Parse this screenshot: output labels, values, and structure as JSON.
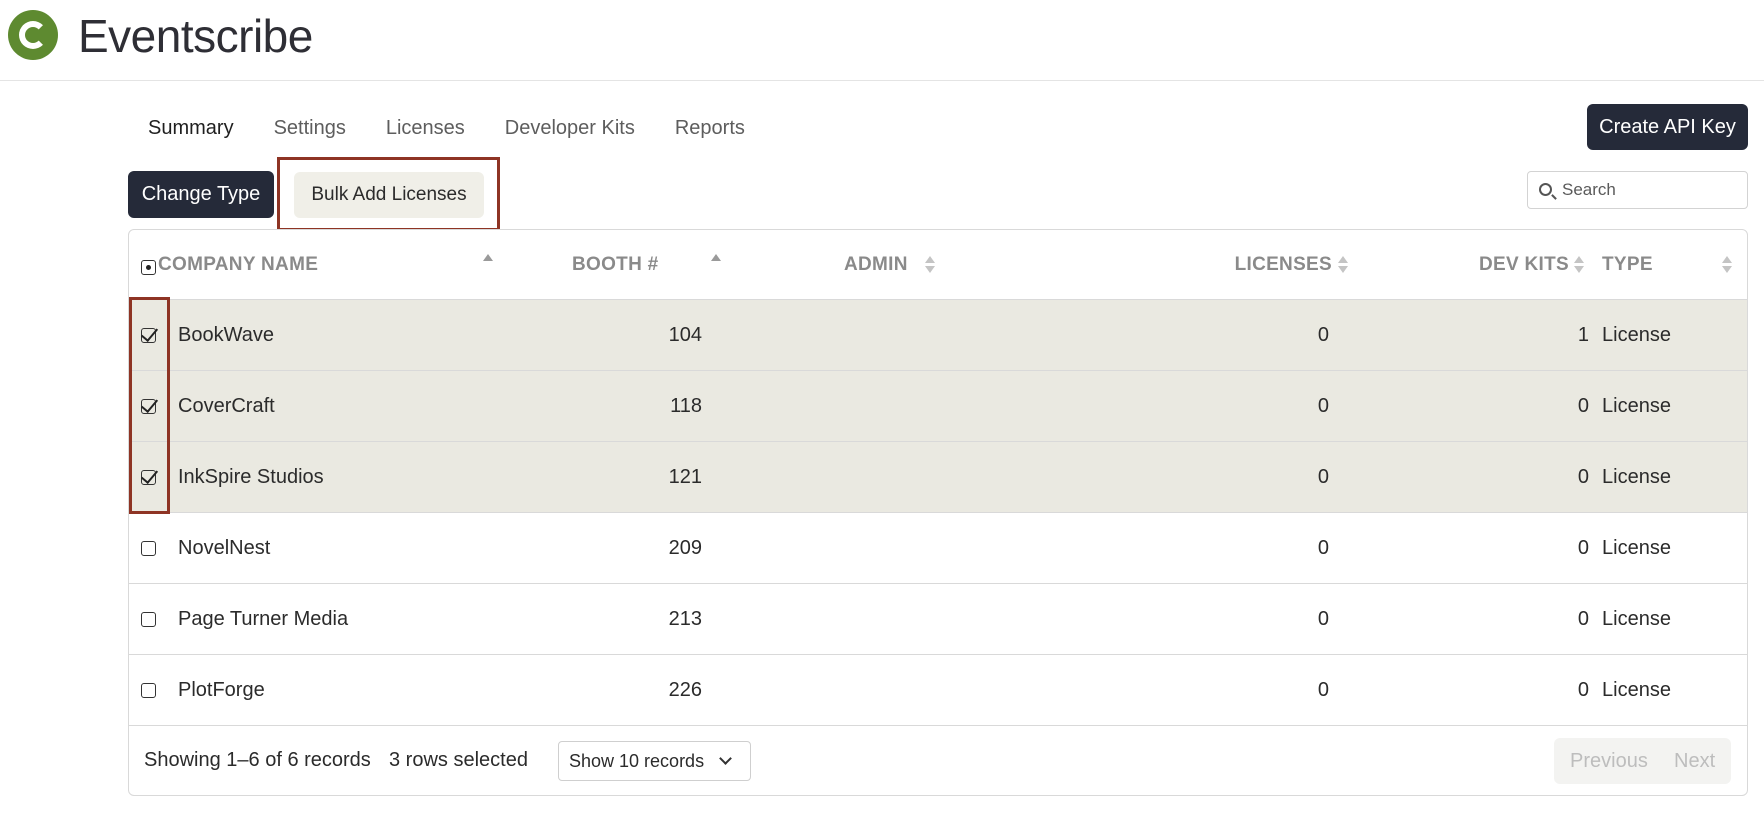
{
  "header": {
    "app_title": "Eventscribe",
    "logo_icon": "eventscribe-logo-icon",
    "brand_color": "#5e8a30"
  },
  "nav": {
    "tabs": [
      {
        "label": "Summary",
        "active": true
      },
      {
        "label": "Settings",
        "active": false
      },
      {
        "label": "Licenses",
        "active": false
      },
      {
        "label": "Developer Kits",
        "active": false
      },
      {
        "label": "Reports",
        "active": false
      }
    ]
  },
  "toolbar": {
    "create_api_key_label": "Create API Key",
    "change_type_label": "Change Type",
    "bulk_add_licenses_label": "Bulk Add Licenses",
    "search_placeholder": "Search"
  },
  "table": {
    "columns": [
      {
        "label": "COMPANY NAME",
        "sort": "asc"
      },
      {
        "label": "BOOTH #",
        "sort": "asc"
      },
      {
        "label": "ADMIN",
        "sort": "none"
      },
      {
        "label": "LICENSES",
        "sort": "none"
      },
      {
        "label": "DEV KITS",
        "sort": "none"
      },
      {
        "label": "TYPE",
        "sort": "none"
      }
    ],
    "header_checkbox_state": "partial",
    "rows": [
      {
        "selected": true,
        "company": "BookWave",
        "booth": "104",
        "admin": "",
        "licenses": "0",
        "dev_kits": "1",
        "type": "License"
      },
      {
        "selected": true,
        "company": "CoverCraft",
        "booth": "118",
        "admin": "",
        "licenses": "0",
        "dev_kits": "0",
        "type": "License"
      },
      {
        "selected": true,
        "company": "InkSpire Studios",
        "booth": "121",
        "admin": "",
        "licenses": "0",
        "dev_kits": "0",
        "type": "License"
      },
      {
        "selected": false,
        "company": "NovelNest",
        "booth": "209",
        "admin": "",
        "licenses": "0",
        "dev_kits": "0",
        "type": "License"
      },
      {
        "selected": false,
        "company": "Page Turner Media",
        "booth": "213",
        "admin": "",
        "licenses": "0",
        "dev_kits": "0",
        "type": "License"
      },
      {
        "selected": false,
        "company": "PlotForge",
        "booth": "226",
        "admin": "",
        "licenses": "0",
        "dev_kits": "0",
        "type": "License"
      }
    ]
  },
  "footer": {
    "showing_text": "Showing 1–6 of 6 records",
    "selected_text": "3 rows selected",
    "page_size_value": "Show 10 records",
    "previous_label": "Previous",
    "next_label": "Next"
  },
  "colors": {
    "dark_button": "#252a39",
    "selected_row": "#eae9e1",
    "highlight": "#8e3424"
  }
}
